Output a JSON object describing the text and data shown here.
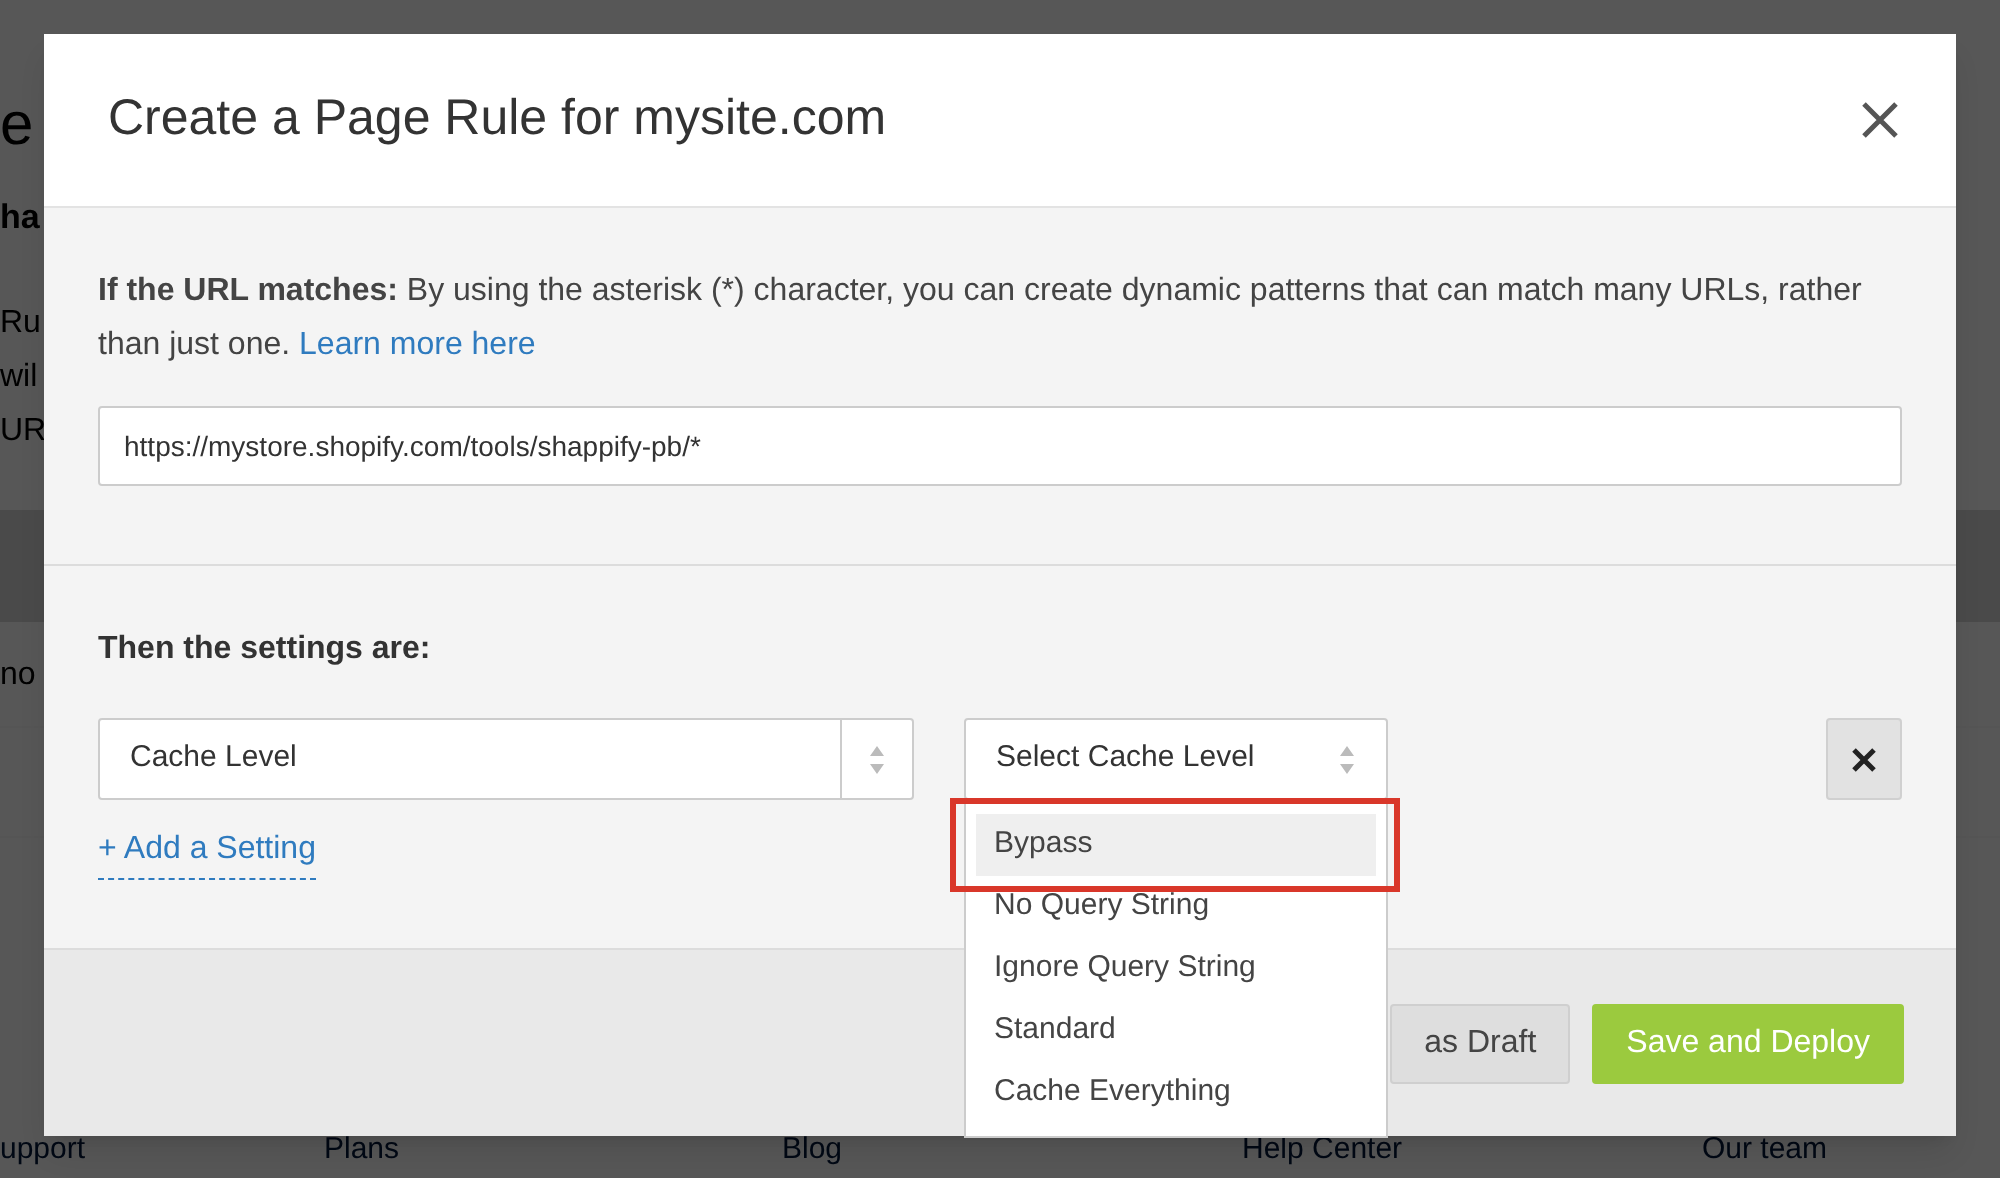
{
  "background_page": {
    "heading_fragment": "e",
    "subheading_fragment": "ha",
    "text_fragments": [
      "Ru",
      "wil",
      "UR"
    ],
    "row_fragment": "no",
    "footer_links": [
      "upport",
      "Plans",
      "Blog",
      "Help Center",
      "Our team"
    ]
  },
  "modal": {
    "title": "Create a Page Rule for mysite.com",
    "url_section": {
      "description": "**If the URL matches:** By using the asterisk (*) character, you can create dynamic patterns that can match many URLs, rather than just one.",
      "link": "Learn more here",
      "value": "https://mystore.shopify.com/tools/shappify-pb/*"
    },
    "settings_section": {
      "heading": "Then the settings are:",
      "setting_select": "Cache Level",
      "value_select": "Select Cache Level",
      "add_link": "+ Add a Setting"
    },
    "dropdown_options": [
      {
        "label": "Bypass",
        "selected": true,
        "outlined": true
      },
      {
        "label": "No Query String",
        "selected": false,
        "outlined": false
      },
      {
        "label": "Ignore Query String",
        "selected": false,
        "outlined": false
      },
      {
        "label": "Standard",
        "selected": false,
        "outlined": false
      },
      {
        "label": "Cache Everything",
        "selected": false,
        "outlined": false
      }
    ],
    "footer_buttons": [
      {
        "label": "as Draft",
        "kind": "secondary"
      },
      {
        "label": "Save and Deploy",
        "kind": "primary"
      }
    ]
  }
}
